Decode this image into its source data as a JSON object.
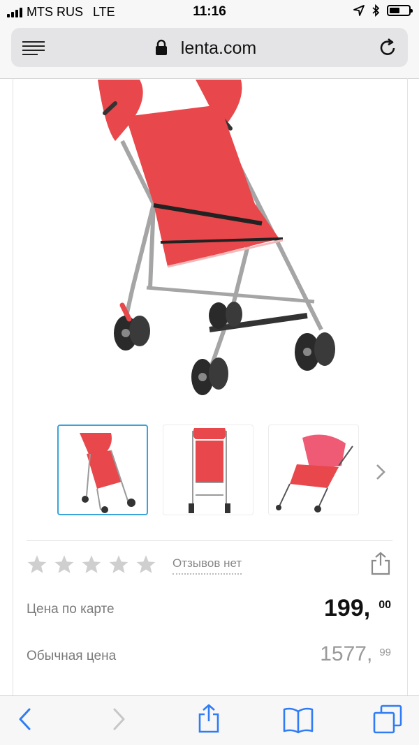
{
  "status": {
    "carrier": "MTS RUS",
    "network": "LTE",
    "time": "11:16",
    "battery_level": 0.55
  },
  "browser": {
    "url": "lenta.com"
  },
  "product": {
    "rating_stars": 0,
    "max_stars": 5,
    "reviews_text": "Отзывов нет",
    "card_price_label": "Цена по карте",
    "card_price_int": "199,",
    "card_price_dec": "00",
    "regular_price_label": "Обычная цена",
    "regular_price_int": "1577,",
    "regular_price_dec": "99"
  },
  "colors": {
    "accent": "#3aa3dc",
    "ios_blue": "#2f7cf6",
    "stroller_red": "#e8474b"
  },
  "icons": [
    "signal-icon",
    "location-icon",
    "bluetooth-icon",
    "battery-icon",
    "menu-icon",
    "lock-icon",
    "reload-icon",
    "chevron-right-icon",
    "star-icon",
    "share-icon",
    "back-icon",
    "forward-icon",
    "bookmarks-icon",
    "tabs-icon"
  ]
}
